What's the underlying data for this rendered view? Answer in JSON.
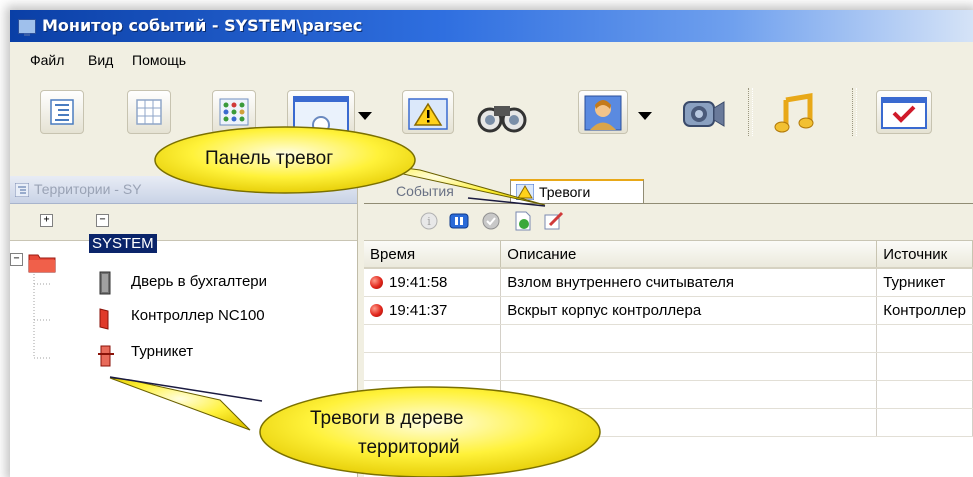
{
  "window": {
    "title": "Монитор событий - SYSTEM\\parsec"
  },
  "menu": {
    "items": [
      "Файл",
      "Вид",
      "Помощь"
    ]
  },
  "left_panel": {
    "header": "Территории - SY",
    "tree": {
      "root": "SYSTEM",
      "children": [
        "Дверь в бухгалтери",
        "Контроллер NC100",
        "Турникет"
      ]
    }
  },
  "right_panel": {
    "tabs": [
      "События",
      "Тревоги"
    ],
    "table": {
      "columns": [
        "Время",
        "Описание",
        "Источник"
      ],
      "rows": [
        {
          "time": "19:41:58",
          "description": "Взлом внутреннего считывателя",
          "source": "Турникет"
        },
        {
          "time": "19:41:37",
          "description": "Вскрыт корпус контроллера",
          "source": "Контроллер"
        }
      ]
    }
  },
  "callouts": {
    "alarm_panel": "Панель тревог",
    "tree_alarms_line1": "Тревоги в дереве",
    "tree_alarms_line2": "территорий"
  },
  "colors": {
    "titlebar": "#0a3fa6",
    "callout_fill": "#fff23a",
    "alarm_dot": "#e1251b",
    "selection": "#0a246a"
  }
}
